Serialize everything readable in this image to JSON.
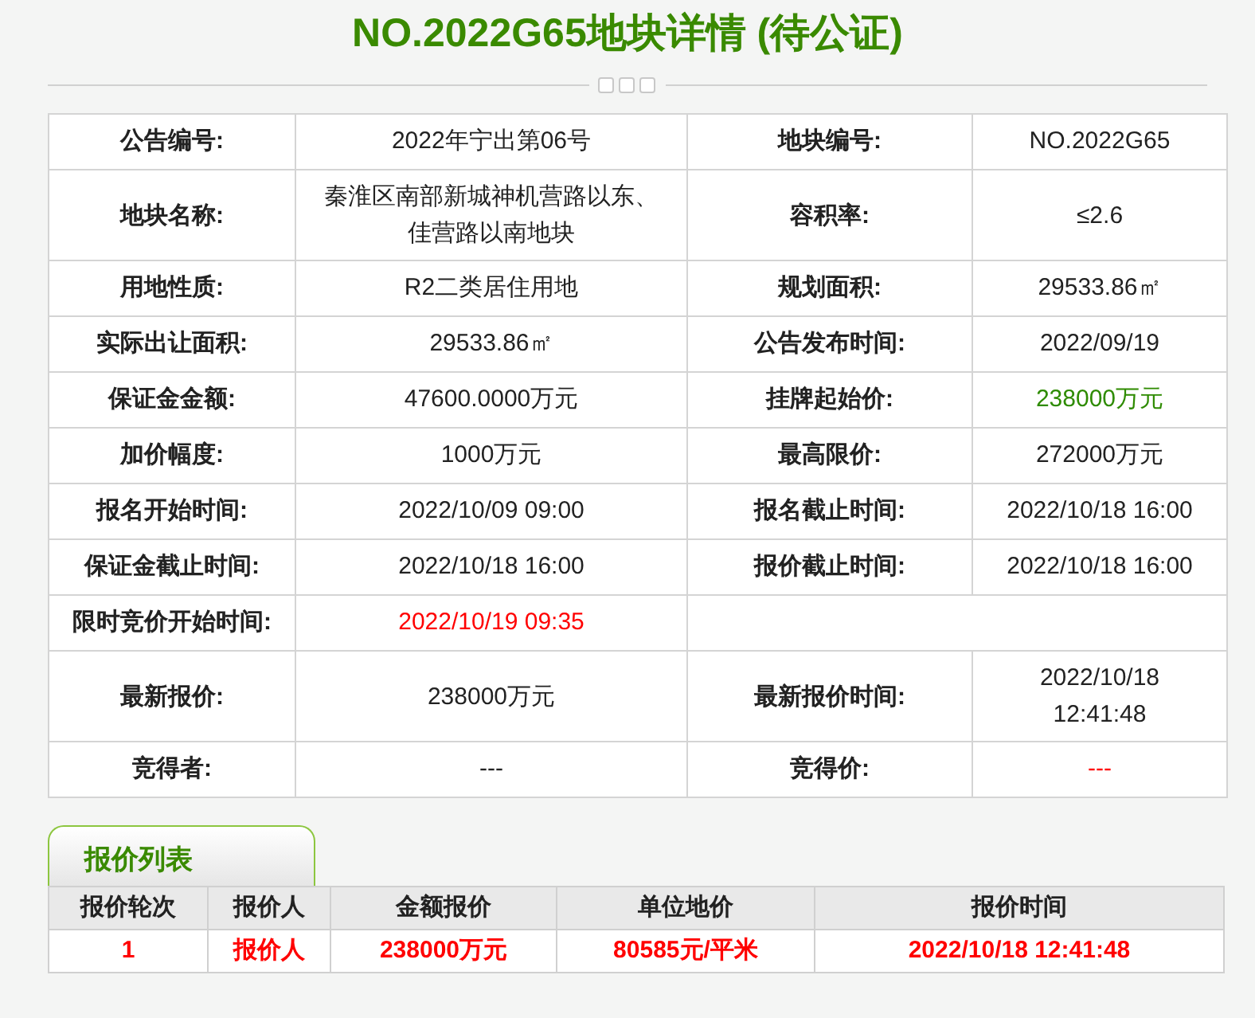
{
  "title": "NO.2022G65地块详情 (待公证)",
  "details": [
    {
      "cells": [
        {
          "kind": "label",
          "text": "公告编号:"
        },
        {
          "kind": "value",
          "text": "2022年宁出第06号"
        },
        {
          "kind": "label",
          "text": "地块编号:"
        },
        {
          "kind": "value",
          "text": "NO.2022G65"
        }
      ]
    },
    {
      "cells": [
        {
          "kind": "label",
          "text": "地块名称:"
        },
        {
          "kind": "value",
          "text": "秦淮区南部新城神机营路以东、佳营路以南地块"
        },
        {
          "kind": "label",
          "text": "容积率:"
        },
        {
          "kind": "value",
          "text": "≤2.6"
        }
      ]
    },
    {
      "cells": [
        {
          "kind": "label",
          "text": "用地性质:"
        },
        {
          "kind": "value",
          "text": "R2二类居住用地"
        },
        {
          "kind": "label",
          "text": "规划面积:"
        },
        {
          "kind": "value",
          "text": "29533.86㎡"
        }
      ]
    },
    {
      "cells": [
        {
          "kind": "label",
          "text": "实际出让面积:"
        },
        {
          "kind": "value",
          "text": "29533.86㎡"
        },
        {
          "kind": "label",
          "text": "公告发布时间:"
        },
        {
          "kind": "value",
          "text": "2022/09/19"
        }
      ]
    },
    {
      "cells": [
        {
          "kind": "label",
          "text": "保证金金额:"
        },
        {
          "kind": "value",
          "text": "47600.0000万元"
        },
        {
          "kind": "label",
          "text": "挂牌起始价:"
        },
        {
          "kind": "value",
          "text": "238000万元",
          "color": "#2e8b00"
        }
      ]
    },
    {
      "cells": [
        {
          "kind": "label",
          "text": "加价幅度:"
        },
        {
          "kind": "value",
          "text": "1000万元"
        },
        {
          "kind": "label",
          "text": "最高限价:"
        },
        {
          "kind": "value",
          "text": "272000万元"
        }
      ]
    },
    {
      "cells": [
        {
          "kind": "label",
          "text": "报名开始时间:"
        },
        {
          "kind": "value",
          "text": "2022/10/09 09:00"
        },
        {
          "kind": "label",
          "text": "报名截止时间:"
        },
        {
          "kind": "value",
          "text": "2022/10/18 16:00"
        }
      ]
    },
    {
      "cells": [
        {
          "kind": "label",
          "text": "保证金截止时间:"
        },
        {
          "kind": "value",
          "text": "2022/10/18 16:00"
        },
        {
          "kind": "label",
          "text": "报价截止时间:"
        },
        {
          "kind": "value",
          "text": "2022/10/18 16:00"
        }
      ]
    },
    {
      "cells": [
        {
          "kind": "label",
          "text": "限时竞价开始时间:"
        },
        {
          "kind": "value",
          "text": "2022/10/19 09:35",
          "color": "#ff0000"
        }
      ]
    },
    {
      "cells": [
        {
          "kind": "label",
          "text": "最新报价:"
        },
        {
          "kind": "value",
          "text": "238000万元"
        },
        {
          "kind": "label",
          "text": "最新报价时间:"
        },
        {
          "kind": "value",
          "text": "2022/10/18 12:41:48"
        }
      ]
    },
    {
      "cells": [
        {
          "kind": "label",
          "text": "竞得者:"
        },
        {
          "kind": "value",
          "text": "---"
        },
        {
          "kind": "label",
          "text": "竞得价:"
        },
        {
          "kind": "value",
          "text": "---",
          "color": "#ff0000"
        }
      ]
    }
  ],
  "bids": {
    "tab": "报价列表",
    "columns": [
      "报价轮次",
      "报价人",
      "金额报价",
      "单位地价",
      "报价时间"
    ],
    "rows": [
      [
        "1",
        "报价人",
        "238000万元",
        "80585元/平米",
        "2022/10/18 12:41:48"
      ]
    ]
  }
}
